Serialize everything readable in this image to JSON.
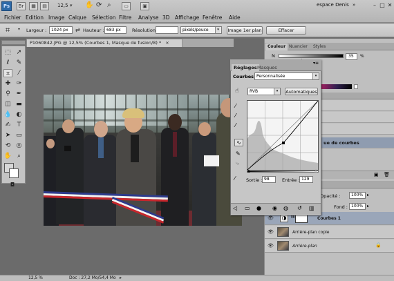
{
  "menubar": {
    "logo": "Ps",
    "zoom": "12,5",
    "items": [
      "Fichier",
      "Edition",
      "Image",
      "Calque",
      "Sélection",
      "Filtre",
      "Analyse",
      "3D",
      "Affichage",
      "Fenêtre",
      "Aide"
    ],
    "workspace": "espace Denis",
    "window_controls": [
      "–",
      "□",
      "✕"
    ]
  },
  "options": {
    "width_label": "Largeur :",
    "width_value": "1024 px",
    "height_label": "Hauteur :",
    "height_value": "683 px",
    "resolution_label": "Résolution :",
    "resolution_value": "",
    "resolution_unit": "pixels/pouce",
    "front_image_button": "Image 1er plan",
    "clear_button": "Effacer"
  },
  "document": {
    "tab_title": "P1060842.JPG @ 12,5% (Courbes 1, Masque de fusion/8) *",
    "tab_close": "×",
    "status_zoom": "12,5 %",
    "status_doc": "Doc : 27,2 Mo/54,4 Mo"
  },
  "color_panel": {
    "tabs": [
      "Couleur",
      "Nuancier",
      "Styles"
    ],
    "channel_label": "N",
    "channel_value": "35",
    "percent": "%"
  },
  "adjustments": {
    "tabs": [
      "Réglages",
      "Masques"
    ],
    "preset_label": "Courbes",
    "preset_value": "Personnalisée",
    "channel_value": "RVB",
    "auto_button": "Automatiques",
    "output_label": "Sortie :",
    "output_value": "98",
    "input_label": "Entrée :",
    "input_value": "129"
  },
  "history": {
    "items": [
      "",
      "",
      "",
      "ue de courbes"
    ]
  },
  "layers": {
    "opacity_label": "Opacité :",
    "opacity_value": "100%",
    "fill_label": "Fond :",
    "fill_value": "100%",
    "items": [
      {
        "name": "Courbes 1"
      },
      {
        "name": "Arrière-plan copie"
      },
      {
        "name": "Arrière-plan"
      }
    ]
  }
}
